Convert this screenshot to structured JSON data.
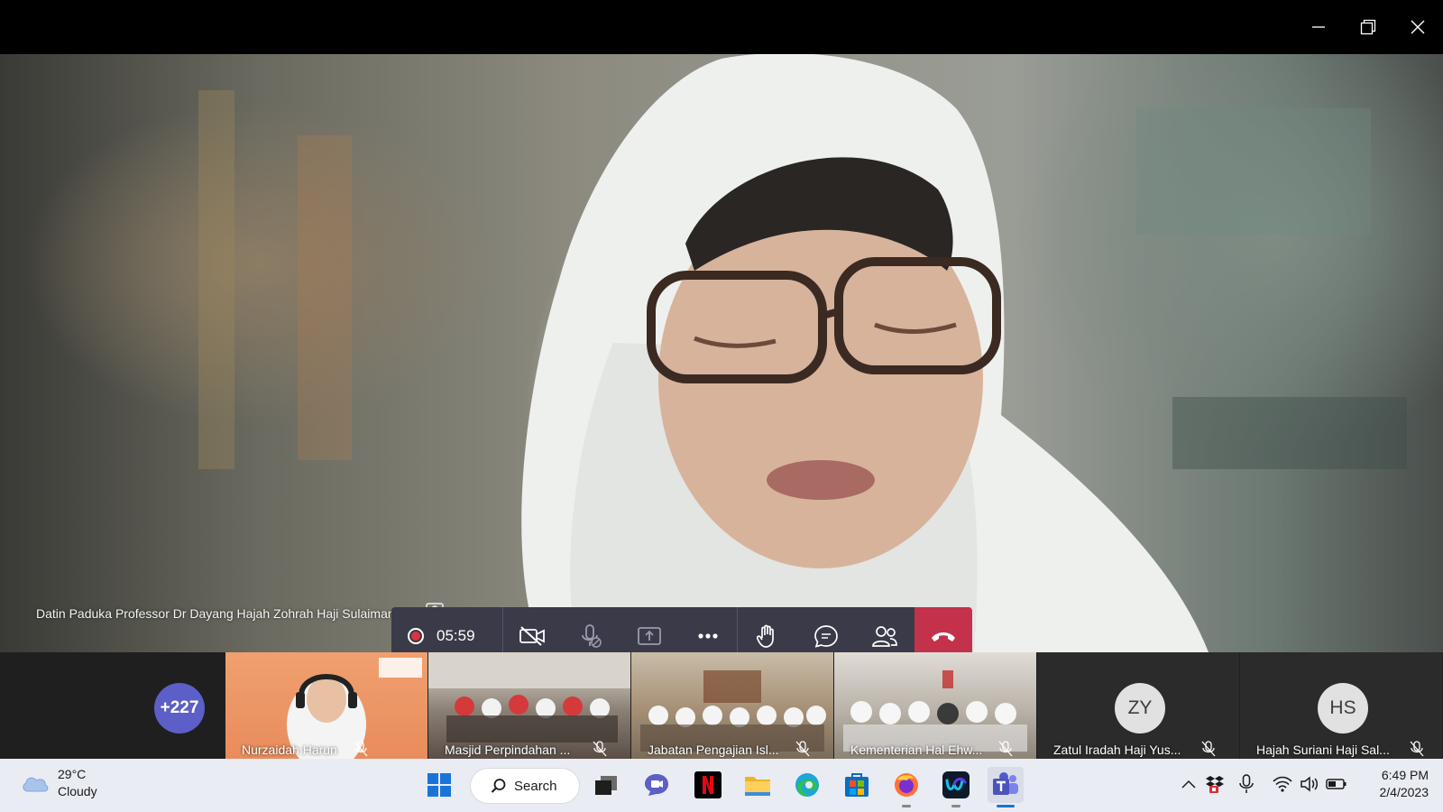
{
  "main_video": {
    "presenter_name": "Datin Paduka Professor Dr Dayang Hajah Zohrah Haji Sulaiman",
    "more_glyph": "···"
  },
  "call_controls": {
    "recording_time": "05:59",
    "icons": [
      "record-icon",
      "camera-off-icon",
      "mic-off-icon",
      "share-screen-icon",
      "more-actions-icon",
      "raise-hand-icon",
      "chat-icon",
      "participants-icon",
      "hang-up-icon"
    ],
    "end_call_color": "#c4314b"
  },
  "gallery": {
    "overflow_count": "+227",
    "tiles": [
      {
        "name": "Nurzaidah Harun",
        "muted": true
      },
      {
        "name": "Masjid Perpindahan ...",
        "muted": true
      },
      {
        "name": "Jabatan Pengajian Isl...",
        "muted": true
      },
      {
        "name": "Kementerian Hal Ehw...",
        "muted": true
      }
    ],
    "avatar_tiles": [
      {
        "initials": "ZY",
        "name": "Zatul Iradah Haji Yus...",
        "muted": true
      },
      {
        "initials": "HS",
        "name": "Hajah Suriani Haji Sal...",
        "muted": true
      }
    ]
  },
  "taskbar": {
    "weather": {
      "temp": "29°C",
      "condition": "Cloudy"
    },
    "search_label": "Search",
    "apps": [
      "windows-start-icon",
      "task-view-icon",
      "teams-chat-icon",
      "netflix-icon",
      "file-explorer-icon",
      "edge-icon",
      "microsoft-store-icon",
      "firefox-icon",
      "webex-icon",
      "teams-icon"
    ],
    "clock": {
      "time": "6:49 PM",
      "date": "2/4/2023"
    },
    "tray": [
      "show-hidden-icons-chevron",
      "dropbox-icon",
      "microphone-icon",
      "wifi-icon",
      "volume-icon",
      "battery-icon"
    ]
  }
}
